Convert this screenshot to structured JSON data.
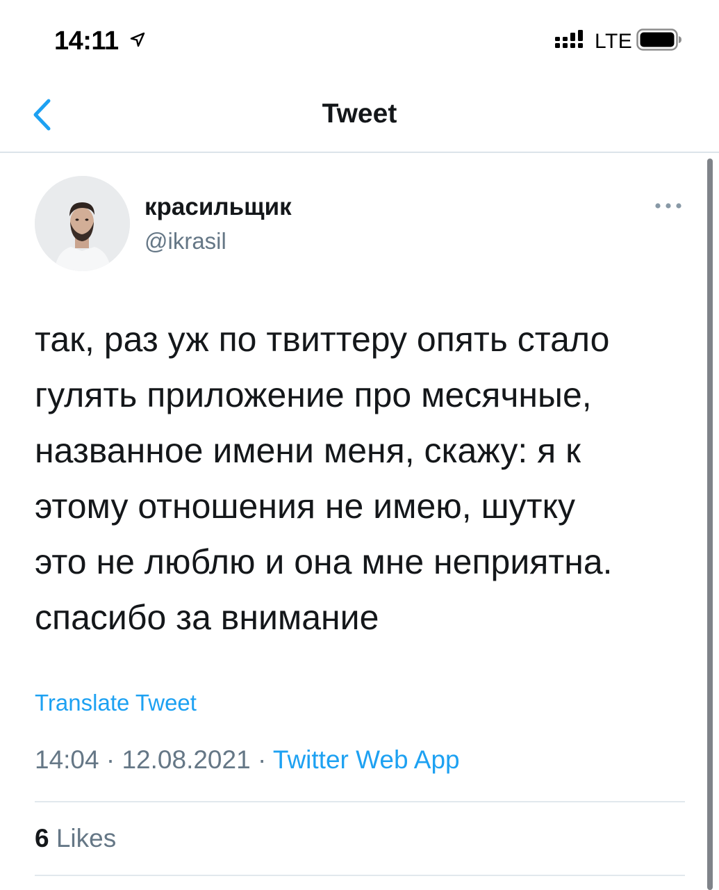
{
  "status_bar": {
    "time": "14:11",
    "network": "LTE",
    "location_icon": "location-arrow-icon",
    "signal_icon": "cellular-signal-icon",
    "battery_icon": "battery-icon"
  },
  "nav": {
    "title": "Tweet",
    "back_icon": "chevron-left-icon"
  },
  "tweet": {
    "author": {
      "display_name": "красильщик",
      "username": "@ikrasil",
      "avatar_icon": "avatar"
    },
    "more_icon": "ellipsis-icon",
    "text": "так, раз уж по твиттеру опять стало\nгулять приложение про месячные,\nназванное имени меня, скажу: я к\nэтому отношения не имею, шутку\nэто не люблю и она мне неприятна.\nспасибо за внимание",
    "translate_label": "Translate Tweet",
    "time": "14:04",
    "separator": " · ",
    "date": "12.08.2021",
    "source": "Twitter Web App",
    "likes_count": "6",
    "likes_label": "Likes"
  },
  "colors": {
    "accent": "#1da1f2",
    "secondary_text": "#657786",
    "primary_text": "#14171a",
    "divider": "#e1e8ed"
  }
}
